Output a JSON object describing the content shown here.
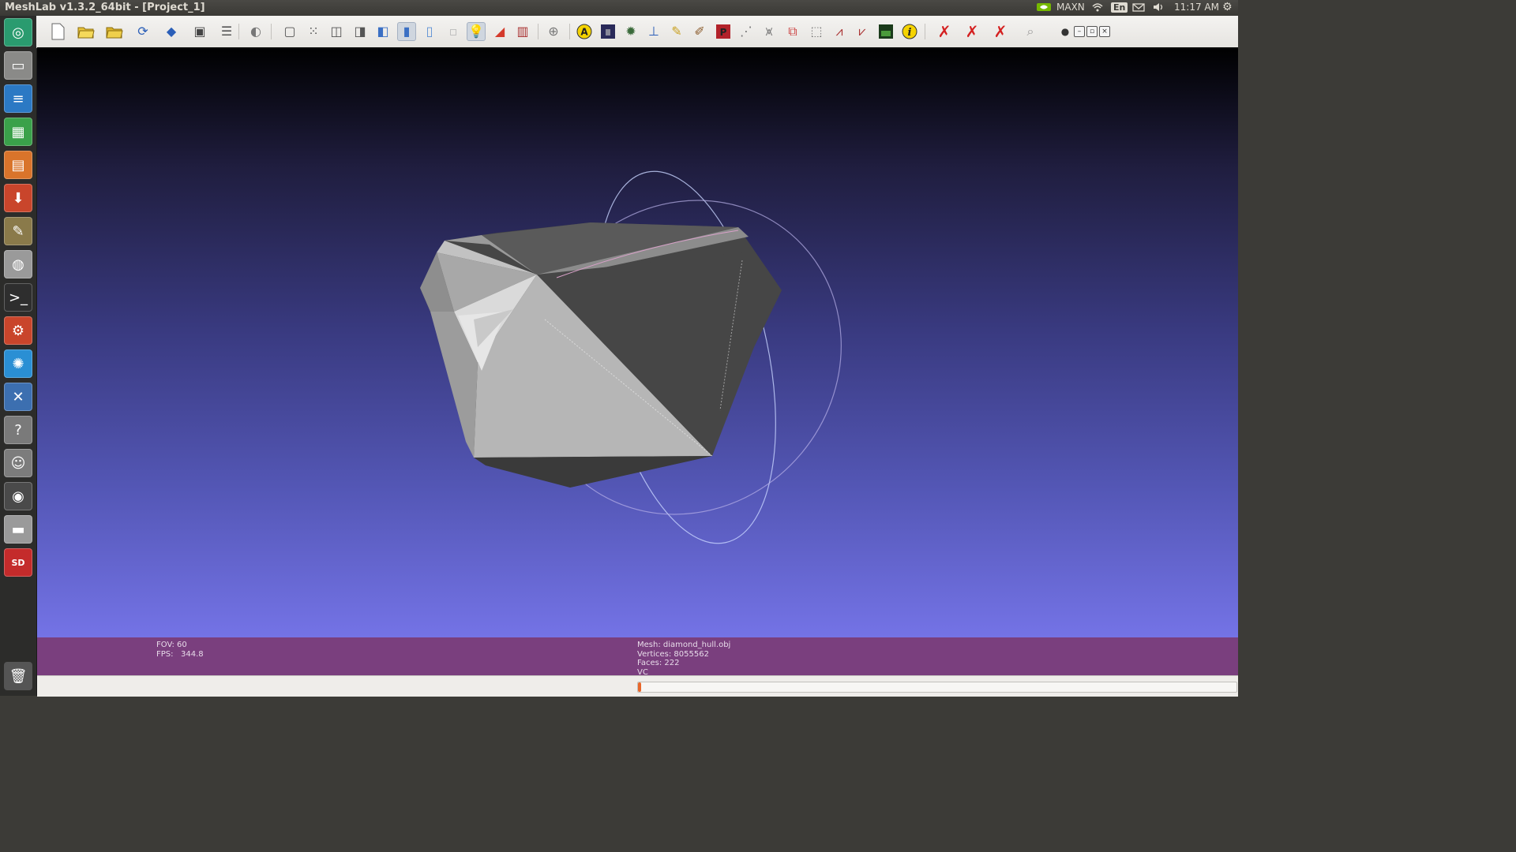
{
  "window": {
    "title": "MeshLab v1.3.2_64bit - [Project_1]"
  },
  "top_panel": {
    "indicators": {
      "nvidia_label": "MAXN",
      "keyboard_label": "En",
      "clock": "11:17 AM"
    }
  },
  "launcher": {
    "items": [
      "ubuntu-dash-icon",
      "files-icon",
      "writer-icon",
      "calc-icon",
      "impress-icon",
      "installer-icon",
      "gimp-icon",
      "trash-bag-icon",
      "terminal-icon",
      "system-settings-icon",
      "blue-app-icon",
      "x-app-icon",
      "help-icon",
      "seal-app-icon",
      "eye-app-icon",
      "drive-icon",
      "sd-card-icon",
      "trash-icon"
    ]
  },
  "toolbar": {
    "buttons": [
      "new-icon",
      "open-icon",
      "open-project-icon",
      "reload-icon",
      "save-icon",
      "snapshot-icon",
      "layers-icon",
      "trackball-icon",
      "bbox-icon",
      "points-icon",
      "wireframe-icon",
      "hidden-lines-icon",
      "flat-lines-icon",
      "flat-icon",
      "smooth-icon",
      "texture-icon",
      "light-icon",
      "color-icon",
      "backface-icon",
      "axis-icon",
      "annotation-icon",
      "image-icon",
      "globe-icon",
      "measure-icon",
      "pick-icon",
      "paint-icon",
      "select-faces-icon",
      "select-vertices-icon",
      "select-connected-icon",
      "align-icon",
      "rect-select-icon",
      "delete-icon",
      "delete2-icon",
      "raster-icon",
      "info-icon",
      "delete-faces-icon",
      "delete-vertices-icon",
      "delete-all-icon",
      "zoom-icon"
    ]
  },
  "viewport": {
    "info_left": {
      "fov": "FOV: 60",
      "fps": "FPS:   344.8"
    },
    "info_right": {
      "mesh": "Mesh: diamond_hull.obj",
      "vertices": "Vertices: 8055562",
      "faces": "Faces: 222",
      "vc": "VC"
    }
  },
  "status_bar": {
    "progress": 0.005
  },
  "colors": {
    "info_bar": "#7a3f7e",
    "progress": "#e8662a",
    "mesh_light": "#b8b8b8",
    "mesh_dark": "#454545"
  }
}
